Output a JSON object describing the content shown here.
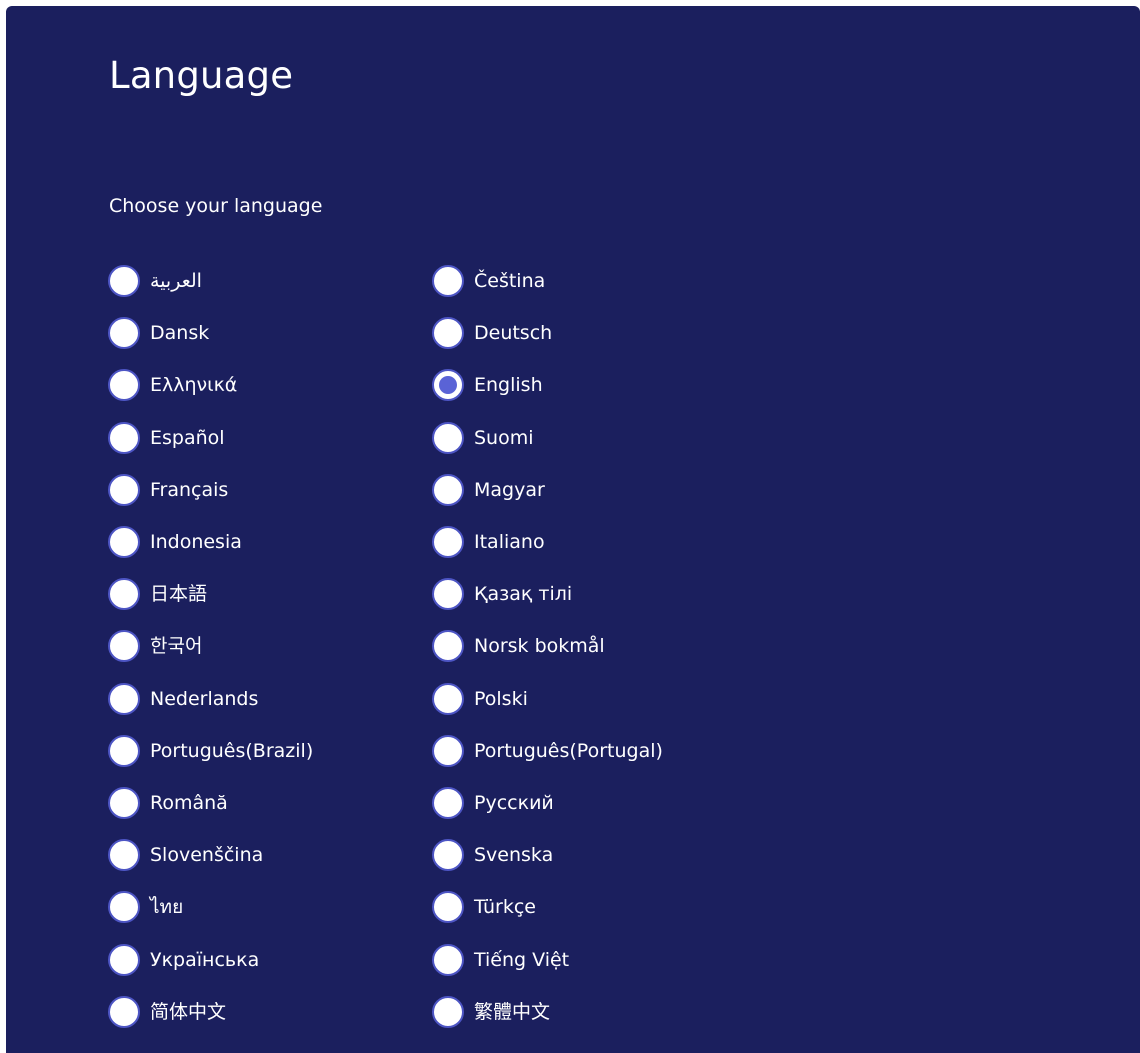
{
  "page": {
    "title": "Language",
    "subtitle": "Choose your language"
  },
  "colors": {
    "background": "#1b1f5e",
    "radio_fill": "#ffffff",
    "radio_border": "#4d55c4",
    "radio_selected_dot": "#5a63d6",
    "text": "#ffffff"
  },
  "selected_language": "English",
  "languages": [
    {
      "label": "العربية",
      "selected": false
    },
    {
      "label": "Čeština",
      "selected": false
    },
    {
      "label": "Dansk",
      "selected": false
    },
    {
      "label": "Deutsch",
      "selected": false
    },
    {
      "label": "Ελληνικά",
      "selected": false
    },
    {
      "label": "English",
      "selected": true
    },
    {
      "label": "Español",
      "selected": false
    },
    {
      "label": "Suomi",
      "selected": false
    },
    {
      "label": "Français",
      "selected": false
    },
    {
      "label": "Magyar",
      "selected": false
    },
    {
      "label": "Indonesia",
      "selected": false
    },
    {
      "label": "Italiano",
      "selected": false
    },
    {
      "label": "日本語",
      "selected": false
    },
    {
      "label": "Қазақ тілі",
      "selected": false
    },
    {
      "label": "한국어",
      "selected": false
    },
    {
      "label": "Norsk bokmål",
      "selected": false
    },
    {
      "label": "Nederlands",
      "selected": false
    },
    {
      "label": "Polski",
      "selected": false
    },
    {
      "label": "Português(Brazil)",
      "selected": false
    },
    {
      "label": "Português(Portugal)",
      "selected": false
    },
    {
      "label": "Română",
      "selected": false
    },
    {
      "label": "Русский",
      "selected": false
    },
    {
      "label": "Slovenščina",
      "selected": false
    },
    {
      "label": "Svenska",
      "selected": false
    },
    {
      "label": "ไทย",
      "selected": false
    },
    {
      "label": "Türkçe",
      "selected": false
    },
    {
      "label": "Українська",
      "selected": false
    },
    {
      "label": "Tiếng Việt",
      "selected": false
    },
    {
      "label": "简体中文",
      "selected": false
    },
    {
      "label": "繁體中文",
      "selected": false
    }
  ]
}
